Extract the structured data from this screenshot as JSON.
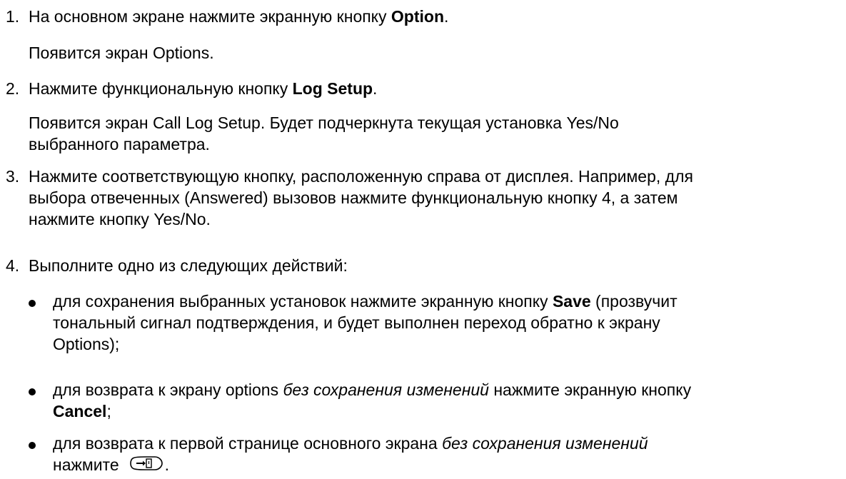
{
  "steps": [
    {
      "num": "1.",
      "pre": "На основном экране нажмите экранную кнопку ",
      "bold": "Option",
      "post": ".",
      "note": "Появится экран Options."
    },
    {
      "num": "2.",
      "pre": "Нажмите функциональную кнопку ",
      "bold": "Log Setup",
      "post": ".",
      "note_line1": "Появится экран Call Log Setup. Будет подчеркнута текущая установка Yes/No",
      "note_line2": "выбранного параметра."
    },
    {
      "num": "3.",
      "line1": "Нажмите соответствующую кнопку, расположенную справа от дисплея. Например, для",
      "line2": "выбора отвеченных (Answered) вызовов нажмите функциональную кнопку 4, а затем",
      "line3": "нажмите кнопку Yes/No."
    },
    {
      "num": "4.",
      "text": "Выполните одно из следующих действий:"
    }
  ],
  "bullets": [
    {
      "pre": "для сохранения выбранных установок нажмите экранную кнопку ",
      "bold": "Save",
      "post_line1": " (прозвучит",
      "line2": "тональный сигнал подтверждения, и будет выполнен переход обратно к экрану",
      "line3": "Options);"
    },
    {
      "pre": "для возврата к экрану options ",
      "italic": "без сохранения изменений",
      "post": " нажмите экранную кнопку",
      "bold": "Cancel",
      "end": ";"
    },
    {
      "pre": "для возврата к первой странице основного экрана ",
      "italic": "без сохранения изменений",
      "line2": "нажмите",
      "end": ".",
      "icon": "home-key-icon"
    }
  ]
}
